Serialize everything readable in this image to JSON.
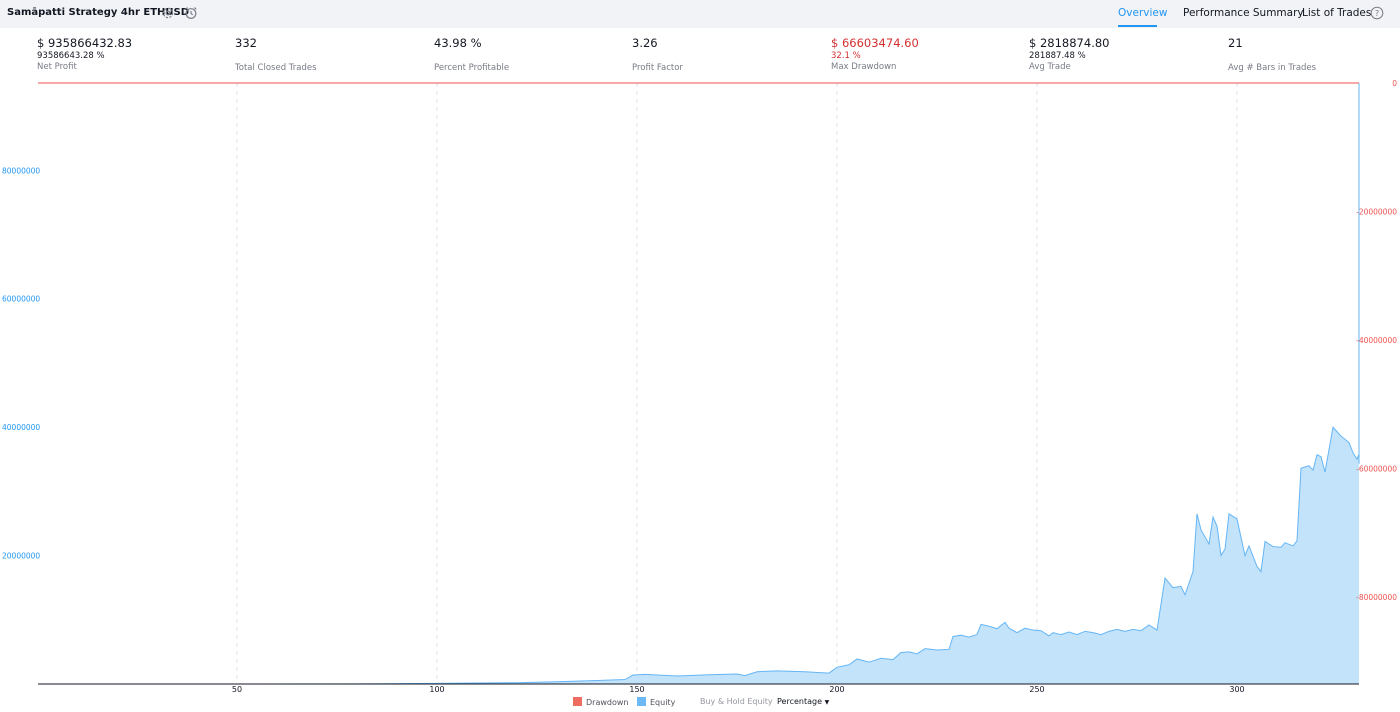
{
  "header": {
    "title": "Samāpatti Strategy 4hr ETHUSD",
    "tabs": {
      "overview": "Overview",
      "performance": "Performance Summary",
      "trades": "List of Trades"
    }
  },
  "stats": {
    "net_profit": {
      "value": "$ 935866432.83",
      "sub": "93586643.28 %",
      "label": "Net Profit"
    },
    "closed_trades": {
      "value": "332",
      "label": "Total Closed Trades"
    },
    "percent_profitable": {
      "value": "43.98 %",
      "label": "Percent Profitable"
    },
    "profit_factor": {
      "value": "3.26",
      "label": "Profit Factor"
    },
    "max_drawdown": {
      "value": "$ 66603474.60",
      "sub": "32.1 %",
      "label": "Max Drawdown"
    },
    "avg_trade": {
      "value": "$ 2818874.80",
      "sub": "281887.48 %",
      "label": "Avg Trade"
    },
    "avg_bars": {
      "value": "21",
      "label": "Avg # Bars in Trades"
    }
  },
  "legend": {
    "drawdown": "Drawdown",
    "equity": "Equity",
    "buy_hold": "Buy & Hold Equity",
    "mode": "Percentage"
  },
  "colors": {
    "equity_fill": "#c3e3fa",
    "equity_line": "#64b5f6",
    "drawdown": "#ef5350",
    "accent": "#2196f3"
  },
  "chart_data": {
    "type": "area",
    "xlim": [
      1,
      332
    ],
    "x_ticks": [
      50,
      100,
      150,
      200,
      250,
      300
    ],
    "left_axis": {
      "ylim": [
        0,
        93586643
      ],
      "ticks": [
        20000000,
        40000000,
        60000000,
        80000000
      ],
      "tick_labels": [
        "20000000",
        "40000000",
        "60000000",
        "80000000"
      ],
      "color": "#2196f3"
    },
    "right_axis": {
      "ylim": [
        -93500000,
        0
      ],
      "ticks": [
        0,
        -20000000,
        -40000000,
        -60000000,
        -80000000
      ],
      "tick_labels": [
        "0",
        "-20000000",
        "-40000000",
        "-60000000",
        "-80000000"
      ],
      "color": "#ef5350"
    },
    "grid": "vertical dashed",
    "series": [
      {
        "name": "Equity",
        "points": [
          [
            1,
            0
          ],
          [
            50,
            0
          ],
          [
            80,
            20000
          ],
          [
            100,
            100000
          ],
          [
            120,
            200000
          ],
          [
            130,
            350000
          ],
          [
            140,
            550000
          ],
          [
            147,
            700000
          ],
          [
            149,
            1400000
          ],
          [
            152,
            1500000
          ],
          [
            160,
            1250000
          ],
          [
            168,
            1450000
          ],
          [
            175,
            1550000
          ],
          [
            177,
            1300000
          ],
          [
            180,
            1900000
          ],
          [
            185,
            2050000
          ],
          [
            192,
            1900000
          ],
          [
            198,
            1700000
          ],
          [
            200,
            2600000
          ],
          [
            203,
            3000000
          ],
          [
            205,
            3900000
          ],
          [
            208,
            3400000
          ],
          [
            211,
            4000000
          ],
          [
            214,
            3800000
          ],
          [
            216,
            4900000
          ],
          [
            218,
            5000000
          ],
          [
            220,
            4700000
          ],
          [
            222,
            5500000
          ],
          [
            225,
            5300000
          ],
          [
            228,
            5400000
          ],
          [
            229,
            7400000
          ],
          [
            231,
            7600000
          ],
          [
            233,
            7300000
          ],
          [
            235,
            7700000
          ],
          [
            236,
            9300000
          ],
          [
            238,
            9000000
          ],
          [
            240,
            8600000
          ],
          [
            242,
            9600000
          ],
          [
            243,
            8700000
          ],
          [
            245,
            8000000
          ],
          [
            247,
            8700000
          ],
          [
            249,
            8400000
          ],
          [
            251,
            8300000
          ],
          [
            253,
            7500000
          ],
          [
            254,
            8000000
          ],
          [
            256,
            7700000
          ],
          [
            258,
            8100000
          ],
          [
            260,
            7700000
          ],
          [
            262,
            8200000
          ],
          [
            264,
            8000000
          ],
          [
            266,
            7700000
          ],
          [
            268,
            8200000
          ],
          [
            270,
            8500000
          ],
          [
            272,
            8200000
          ],
          [
            274,
            8500000
          ],
          [
            276,
            8300000
          ],
          [
            278,
            9200000
          ],
          [
            280,
            8400000
          ],
          [
            282,
            16500000
          ],
          [
            284,
            15000000
          ],
          [
            286,
            15200000
          ],
          [
            287,
            13900000
          ],
          [
            289,
            17500000
          ],
          [
            290,
            26500000
          ],
          [
            291,
            24000000
          ],
          [
            293,
            21800000
          ],
          [
            294,
            26000000
          ],
          [
            295,
            24600000
          ],
          [
            296,
            20000000
          ],
          [
            297,
            21000000
          ],
          [
            298,
            26500000
          ],
          [
            300,
            25700000
          ],
          [
            302,
            20000000
          ],
          [
            303,
            21500000
          ],
          [
            305,
            18300000
          ],
          [
            306,
            17500000
          ],
          [
            307,
            22200000
          ],
          [
            309,
            21400000
          ],
          [
            311,
            21300000
          ],
          [
            312,
            22000000
          ],
          [
            314,
            21500000
          ],
          [
            315,
            22300000
          ],
          [
            316,
            33600000
          ],
          [
            318,
            34000000
          ],
          [
            319,
            33300000
          ],
          [
            320,
            35700000
          ],
          [
            321,
            35400000
          ],
          [
            322,
            33000000
          ],
          [
            324,
            40000000
          ],
          [
            326,
            38600000
          ],
          [
            328,
            37600000
          ],
          [
            329,
            36000000
          ],
          [
            330,
            35000000
          ],
          [
            331,
            35800000
          ],
          [
            332,
            34700000
          ],
          [
            333,
            36500000
          ],
          [
            335,
            36000000
          ],
          [
            336,
            34300000
          ],
          [
            338,
            38000000
          ],
          [
            339,
            43000000
          ],
          [
            340,
            50000000
          ],
          [
            341,
            55000000
          ],
          [
            342,
            65000000
          ],
          [
            343,
            93586643
          ]
        ]
      },
      {
        "name": "Drawdown",
        "values": [
          0
        ]
      }
    ]
  }
}
